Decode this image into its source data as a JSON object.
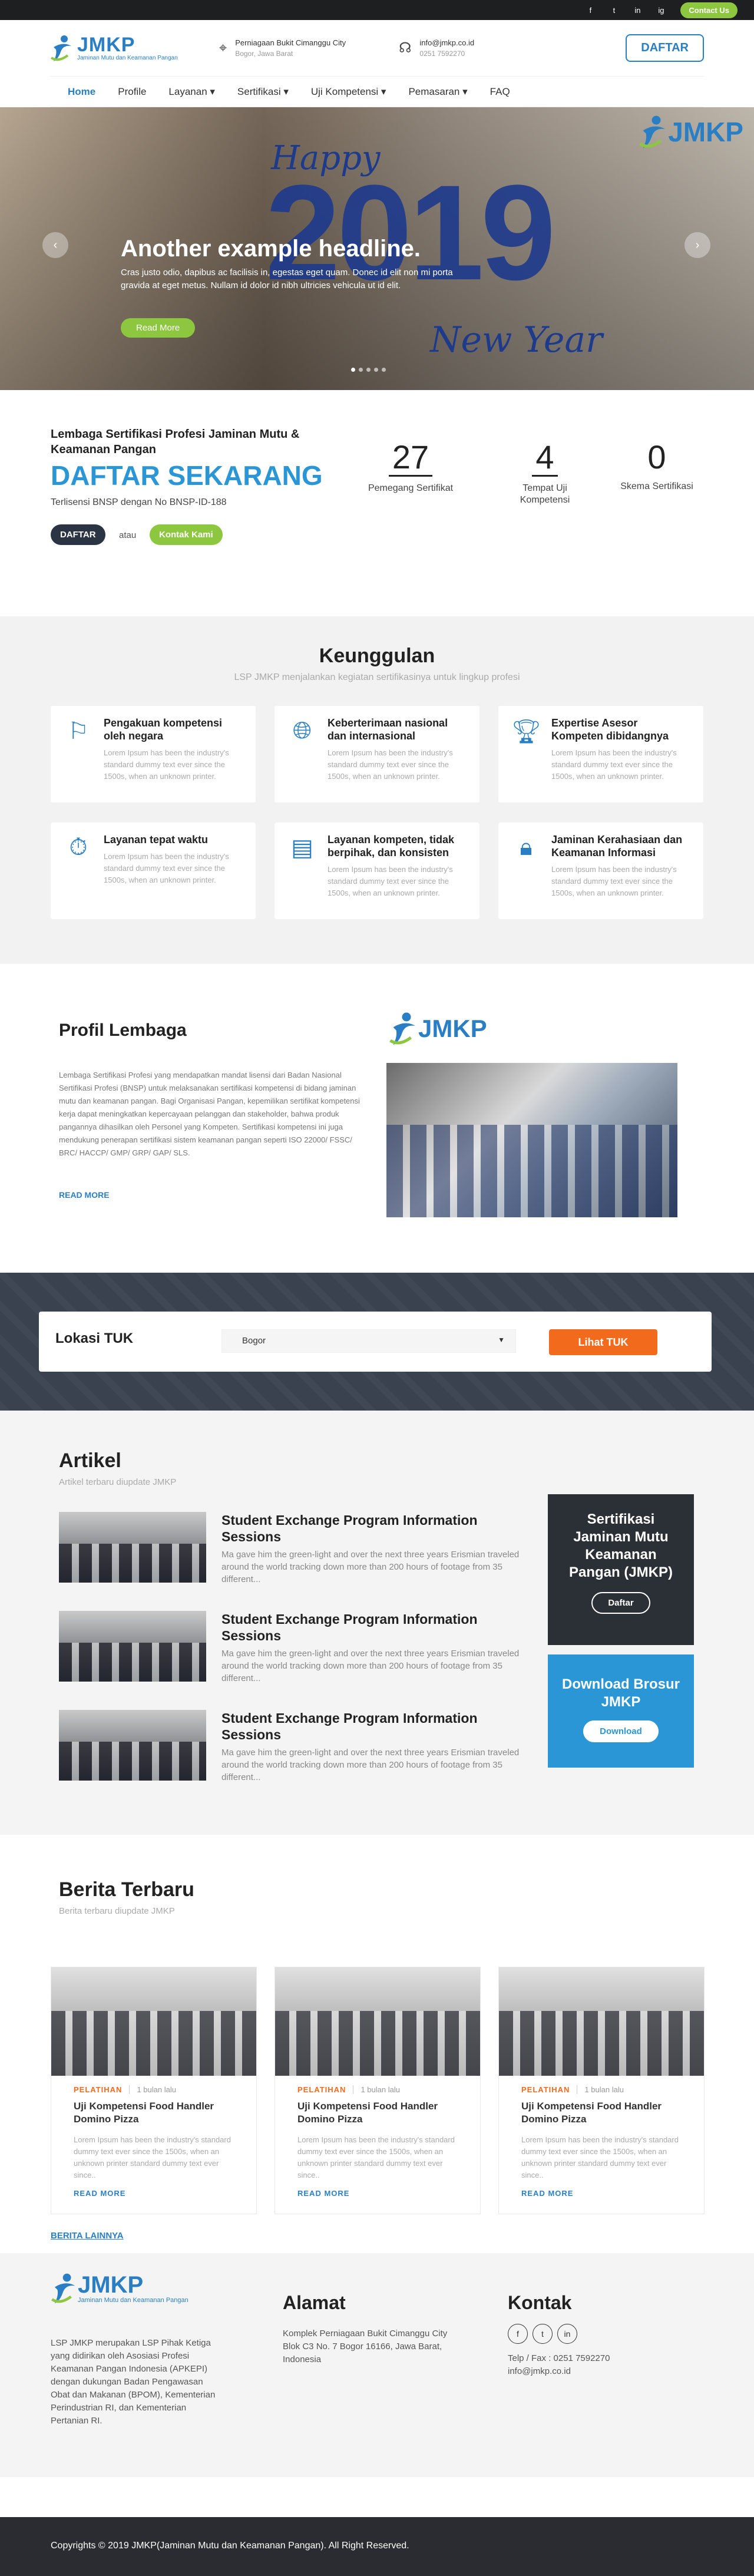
{
  "topbar": {
    "social": [
      "f",
      "t",
      "in",
      "ig"
    ],
    "contact_label": "Contact Us"
  },
  "header": {
    "logo_text": "JMKP",
    "logo_sub": "Jaminan Mutu dan Keamanan Pangan",
    "address_line1": "Perniagaan Bukit Cimanggu City",
    "address_line2": "Bogor, Jawa Barat",
    "email": "info@jmkp.co.id",
    "phone": "0251 7592270",
    "daftar_label": "DAFTAR"
  },
  "nav": {
    "items": [
      "Home",
      "Profile",
      "Layanan ▾",
      "Sertifikasi ▾",
      "Uji Kompetensi ▾",
      "Pemasaran ▾",
      "FAQ"
    ]
  },
  "hero": {
    "happy": "Happy",
    "year": "2019",
    "new_year": "New Year",
    "logo_text": "JMKP",
    "headline": "Another example headline.",
    "text": "Cras justo odio, dapibus ac facilisis in, egestas eget quam. Donec id elit non mi porta gravida at eget metus. Nullam id dolor id nibh ultricies vehicula ut id elit.",
    "button": "Read More"
  },
  "cta": {
    "lead": "Lembaga Sertifikasi Profesi Jaminan Mutu & Keamanan Pangan",
    "big": "DAFTAR SEKARANG",
    "license": "Terlisensi BNSP dengan No BNSP-ID-188",
    "btn_daftar": "DAFTAR",
    "or": "atau",
    "btn_kontak": "Kontak Kami",
    "stats": [
      {
        "num": "27",
        "label": "Pemegang Sertifikat"
      },
      {
        "num": "4",
        "label": "Tempat Uji Kompetensi"
      },
      {
        "num": "0",
        "label": "Skema Sertifikasi"
      }
    ]
  },
  "keunggulan": {
    "title": "Keunggulan",
    "subtitle": "LSP JMKP menjalankan kegiatan sertifikasinya untuk lingkup profesi",
    "items": [
      {
        "icon": "flag-icon",
        "title": "Pengakuan kompetensi oleh negara",
        "desc": "Lorem Ipsum has been the industry's standard dummy text ever since the 1500s, when an unknown printer."
      },
      {
        "icon": "globe-icon",
        "title": "Keberterimaan nasional dan internasional",
        "desc": "Lorem Ipsum has been the industry's standard dummy text ever since the 1500s, when an unknown printer."
      },
      {
        "icon": "trophy-icon",
        "title": "Expertise Asesor Kompeten dibidangnya",
        "desc": "Lorem Ipsum has been the industry's standard dummy text ever since the 1500s, when an unknown printer."
      },
      {
        "icon": "stopwatch-icon",
        "title": "Layanan tepat waktu",
        "desc": "Lorem Ipsum has been the industry's standard dummy text ever since the 1500s, when an unknown printer."
      },
      {
        "icon": "presentation-icon",
        "title": "Layanan kompeten, tidak berpihak, dan konsisten",
        "desc": "Lorem Ipsum has been the industry's standard dummy text ever since the 1500s, when an unknown printer."
      },
      {
        "icon": "lock-laptop-icon",
        "title": "Jaminan Kerahasiaan dan Keamanan Informasi",
        "desc": "Lorem Ipsum has been the industry's standard dummy text ever since the 1500s, when an unknown printer."
      }
    ]
  },
  "profil": {
    "title": "Profil Lembaga",
    "text": "Lembaga Sertifikasi Profesi yang mendapatkan mandat lisensi dari Badan Nasional Sertifikasi Profesi (BNSP) untuk melaksanakan sertifikasi kompetensi di bidang jaminan mutu dan keamanan pangan. Bagi Organisasi Pangan, kepemilikan sertifikat kompetensi kerja dapat meningkatkan kepercayaan pelanggan dan stakeholder, bahwa produk pangannya dihasilkan oleh Personel yang Kompeten. Sertifikasi kompetensi ini juga mendukung penerapan sertifikasi sistem keamanan pangan seperti ISO 22000/ FSSC/ BRC/ HACCP/ GMP/ GRP/ GAP/ SLS.",
    "read_more": "READ MORE",
    "logo_text": "JMKP"
  },
  "lokasi": {
    "title": "Lokasi TUK",
    "selected": "Bogor",
    "button": "Lihat TUK"
  },
  "artikel": {
    "title": "Artikel",
    "subtitle": "Artikel terbaru diupdate JMKP",
    "items": [
      {
        "title": "Student Exchange Program Information Sessions",
        "desc": "Ma gave him the green-light and over the next three years Erismian traveled around the world tracking down more than 200 hours of footage from 35 different..."
      },
      {
        "title": "Student Exchange Program Information Sessions",
        "desc": "Ma gave him the green-light and over the next three years Erismian traveled around the world tracking down more than 200 hours of footage from 35 different..."
      },
      {
        "title": "Student Exchange Program Information Sessions",
        "desc": "Ma gave him the green-light and over the next three years Erismian traveled around the world tracking down more than 200 hours of footage from 35 different..."
      }
    ],
    "side1": {
      "title": "Sertifikasi Jaminan Mutu Keamanan Pangan (JMKP)",
      "button": "Daftar",
      "color": "#2b2f36"
    },
    "side2": {
      "title": "Download Brosur JMKP",
      "button": "Download",
      "color": "#2a96d6"
    }
  },
  "berita": {
    "title": "Berita Terbaru",
    "subtitle": "Berita terbaru diupdate JMKP",
    "items": [
      {
        "cat": "PELATIHAN",
        "ago": "1 bulan lalu",
        "title": "Uji Kompetensi Food Handler Domino Pizza",
        "desc": "Lorem Ipsum has been the industry's standard dummy text ever since the 1500s, when an unknown printer standard dummy text ever since..",
        "more": "READ MORE"
      },
      {
        "cat": "PELATIHAN",
        "ago": "1 bulan lalu",
        "title": "Uji Kompetensi Food Handler Domino Pizza",
        "desc": "Lorem Ipsum has been the industry's standard dummy text ever since the 1500s, when an unknown printer standard dummy text ever since..",
        "more": "READ MORE"
      },
      {
        "cat": "PELATIHAN",
        "ago": "1 bulan lalu",
        "title": "Uji Kompetensi Food Handler Domino Pizza",
        "desc": "Lorem Ipsum has been the industry's standard dummy text ever since the 1500s, when an unknown printer standard dummy text ever since..",
        "more": "READ MORE"
      }
    ],
    "more": "BERITA LAINNYA"
  },
  "footer": {
    "logo_text": "JMKP",
    "logo_sub": "Jaminan Mutu dan Keamanan Pangan",
    "desc": "LSP JMKP merupakan LSP Pihak Ketiga yang didirikan oleh Asosiasi Profesi Keamanan Pangan Indonesia (APKEPI) dengan dukungan Badan Pengawasan Obat dan Makanan (BPOM), Kementerian Perindustrian RI, dan Kementerian Pertanian RI.",
    "alamat_title": "Alamat",
    "alamat": "Komplek Perniagaan Bukit Cimanggu City Blok C3 No. 7 Bogor 16166, Jawa Barat, Indonesia",
    "kontak_title": "Kontak",
    "social": [
      "f",
      "t",
      "in"
    ],
    "telp": "Telp / Fax : 0251 7592270",
    "email": "info@jmkp.co.id"
  },
  "copyright": "Copyrights © 2019 JMKP(Jaminan Mutu dan Keamanan Pangan). All Right Reserved."
}
